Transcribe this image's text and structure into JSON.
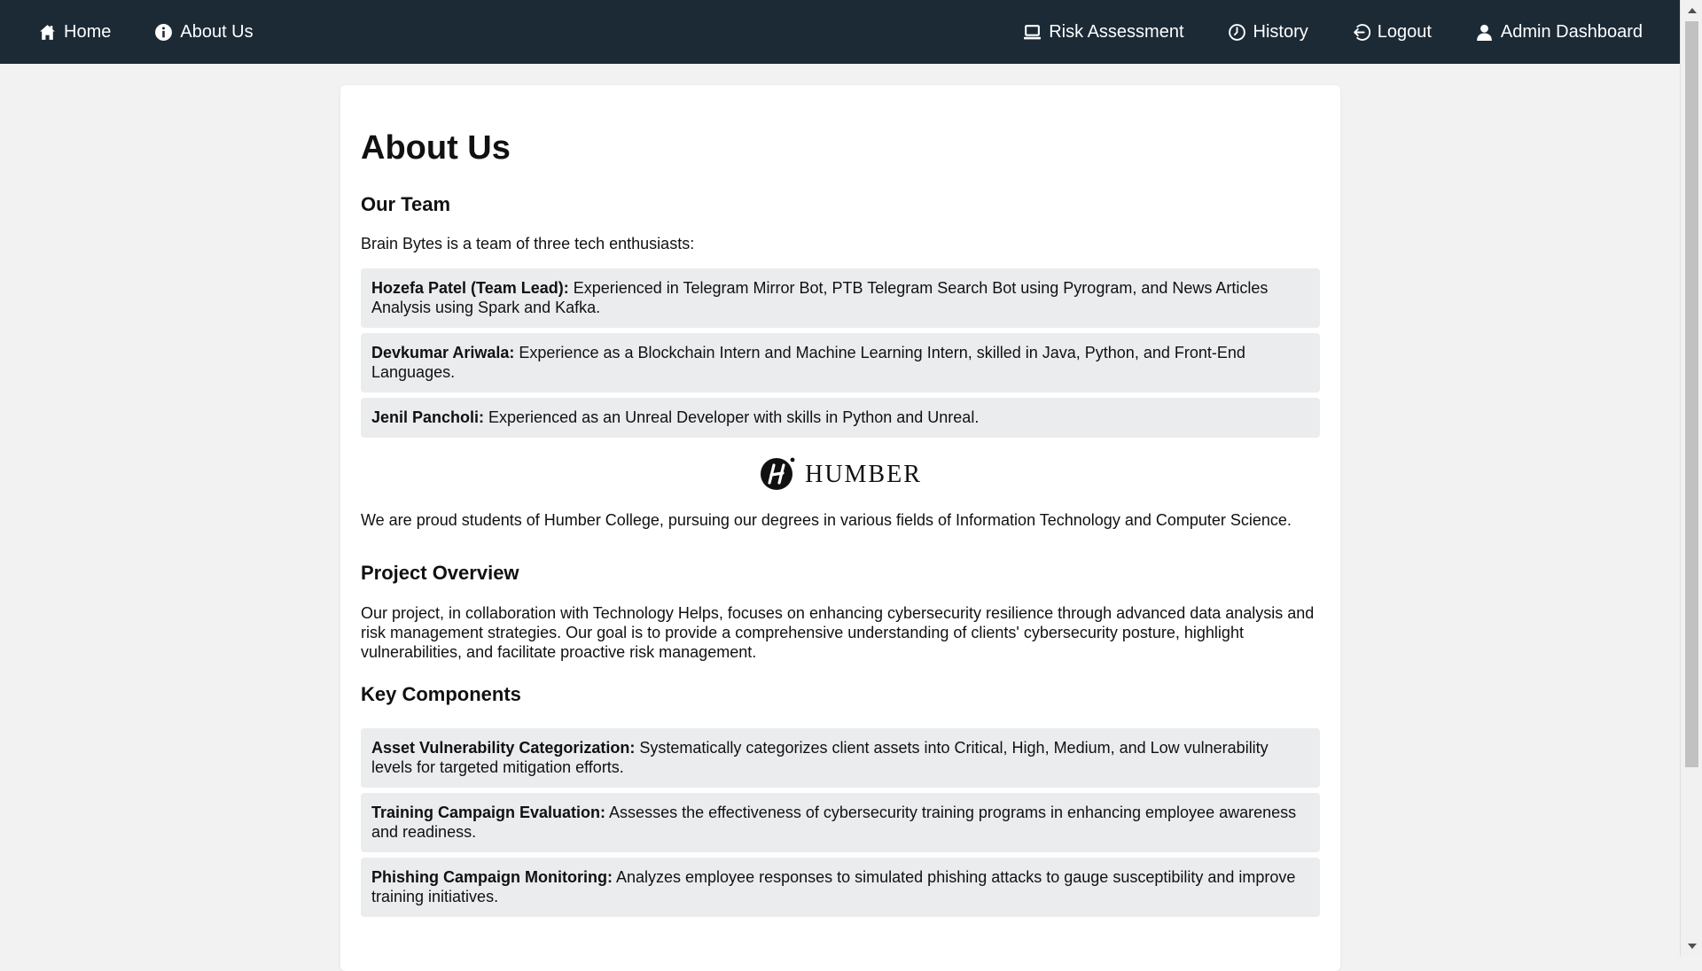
{
  "nav": {
    "home": "Home",
    "about": "About Us",
    "risk": "Risk Assessment",
    "history": "History",
    "logout": "Logout",
    "admin": "Admin Dashboard"
  },
  "page": {
    "title": "About Us",
    "team_heading": "Our Team",
    "team_intro": "Brain Bytes is a team of three tech enthusiasts:",
    "members": [
      {
        "name": "Hozefa Patel (Team Lead):",
        "desc": " Experienced in Telegram Mirror Bot, PTB Telegram Search Bot using Pyrogram, and News Articles Analysis using Spark and Kafka."
      },
      {
        "name": "Devkumar Ariwala:",
        "desc": " Experience as a Blockchain Intern and Machine Learning Intern, skilled in Java, Python, and Front-End Languages."
      },
      {
        "name": "Jenil Pancholi:",
        "desc": " Experienced as an Unreal Developer with skills in Python and Unreal."
      }
    ],
    "logo_text": "HUMBER",
    "humber_text": "We are proud students of Humber College, pursuing our degrees in various fields of Information Technology and Computer Science.",
    "project_heading": "Project Overview",
    "project_text": "Our project, in collaboration with Technology Helps, focuses on enhancing cybersecurity resilience through advanced data analysis and risk management strategies. Our goal is to provide a comprehensive understanding of clients' cybersecurity posture, highlight vulnerabilities, and facilitate proactive risk management.",
    "components_heading": "Key Components",
    "components": [
      {
        "name": "Asset Vulnerability Categorization:",
        "desc": " Systematically categorizes client assets into Critical, High, Medium, and Low vulnerability levels for targeted mitigation efforts."
      },
      {
        "name": "Training Campaign Evaluation:",
        "desc": " Assesses the effectiveness of cybersecurity training programs in enhancing employee awareness and readiness."
      },
      {
        "name": "Phishing Campaign Monitoring:",
        "desc": " Analyzes employee responses to simulated phishing attacks to gauge susceptibility and improve training initiatives."
      }
    ]
  },
  "icons": {
    "home": "home-icon",
    "about": "info-icon",
    "risk": "laptop-icon",
    "history": "clock-icon",
    "logout": "logout-icon",
    "admin": "user-icon"
  },
  "colors": {
    "navbar": "#1b2a35",
    "page_bg": "#f2f2f2",
    "card_bg": "#ffffff",
    "item_bg": "#eaeced"
  }
}
